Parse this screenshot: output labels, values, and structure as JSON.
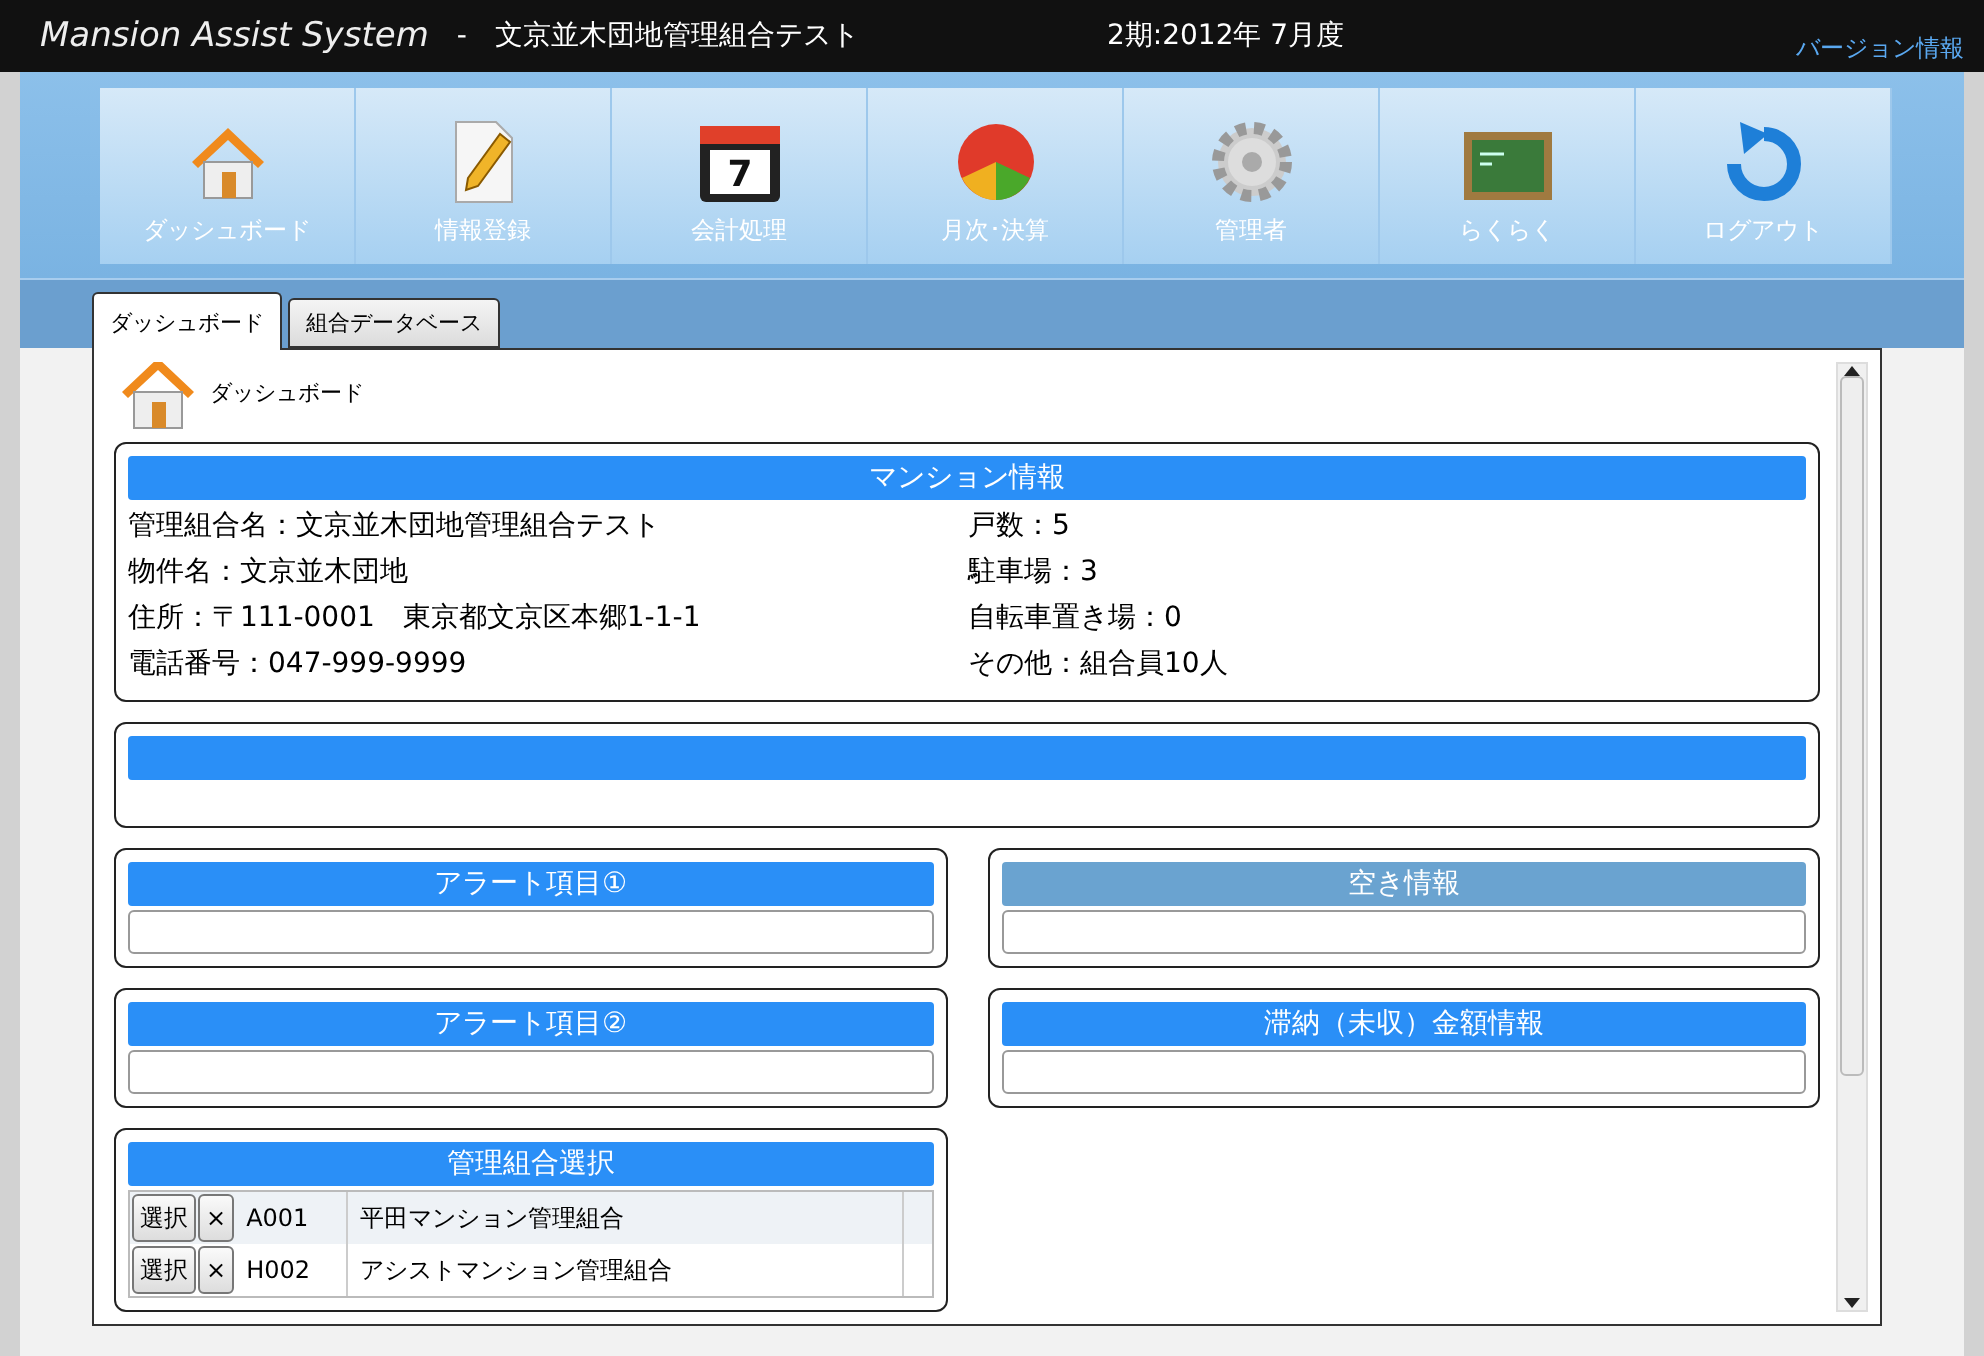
{
  "header": {
    "app_title": "Mansion Assist System",
    "separator": "-",
    "association": "文京並木団地管理組合テスト",
    "period": "2期:2012年 7月度",
    "version_link": "バージョン情報"
  },
  "nav": [
    {
      "kind": "house",
      "label": "ダッシュボード"
    },
    {
      "kind": "pencil",
      "label": "情報登録"
    },
    {
      "kind": "calendar",
      "label": "会計処理",
      "icon_text": "7"
    },
    {
      "kind": "chart",
      "label": "月次･決算"
    },
    {
      "kind": "gear",
      "label": "管理者"
    },
    {
      "kind": "board",
      "label": "らくらく"
    },
    {
      "kind": "logout",
      "label": "ログアウト"
    }
  ],
  "tabs": [
    {
      "label": "ダッシュボード",
      "selected": true
    },
    {
      "label": "組合データベース",
      "selected": false
    }
  ],
  "page_title": "ダッシュボード",
  "mansion_info": {
    "title": "マンション情報",
    "left": [
      "管理組合名：文京並木団地管理組合テスト",
      "物件名：文京並木団地",
      "住所：〒111-0001　東京都文京区本郷1-1-1",
      "電話番号：047-999-9999"
    ],
    "right": [
      "戸数：5",
      "駐車場：3",
      "自転車置き場：0",
      "その他：組合員10人"
    ]
  },
  "panels": [
    {
      "title": "アラート項目①",
      "color": "#2a8ff7"
    },
    {
      "title": "空き情報",
      "color": "#6aa3d0"
    },
    {
      "title": "アラート項目②",
      "color": "#2a8ff7"
    },
    {
      "title": "滞納（未収）金額情報",
      "color": "#2a8ff7"
    }
  ],
  "selection": {
    "title": "管理組合選択",
    "rows": [
      {
        "select_label": "選択",
        "remove_label": "×",
        "code": "A001",
        "name": "平田マンション管理組合"
      },
      {
        "select_label": "選択",
        "remove_label": "×",
        "code": "H002",
        "name": "アシストマンション管理組合"
      }
    ]
  }
}
